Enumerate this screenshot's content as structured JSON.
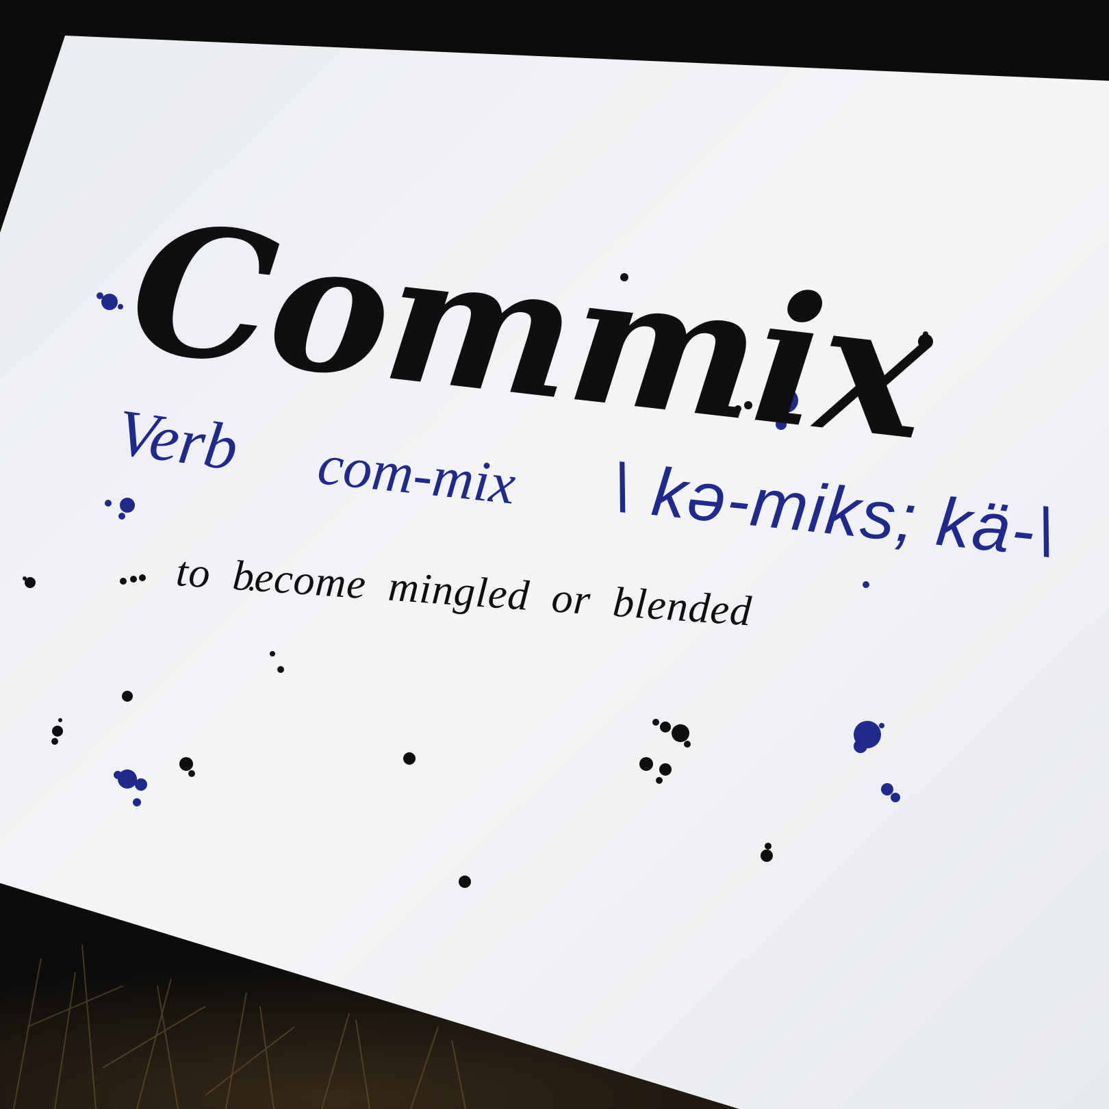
{
  "card": {
    "headword": "Commix",
    "part_of_speech": "Verb",
    "syllables": "com-mix",
    "pronunciation": "\\ kə-miks; kä-\\",
    "definition": "to become mingled or blended"
  },
  "colors": {
    "background": "#0d0c0b",
    "paper": "#f3f4f6",
    "black_ink": "#0f0f12",
    "blue_ink": "#1f2a8c"
  }
}
